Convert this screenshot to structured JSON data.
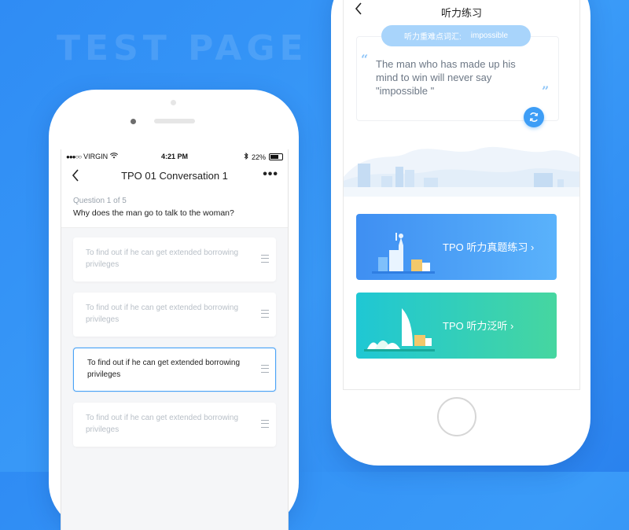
{
  "background_text": "TEST PAGE",
  "colors": {
    "background": "#2f8cf4",
    "accent": "#4aa3f6",
    "card_blue": "#3f8ff2",
    "card_green": "#1fc7d4"
  },
  "left_phone": {
    "status_bar": {
      "carrier": "VIRGIN",
      "time": "4:21 PM",
      "battery": "22%"
    },
    "nav": {
      "back_icon": "chevron-left-icon",
      "title": "TPO 01 Conversation 1",
      "more_icon": "more-horizontal-icon",
      "more_label": "•••"
    },
    "question": {
      "number": "Question 1 of 5",
      "text": "Why does the man go to talk to the woman?"
    },
    "options": [
      {
        "text": "To find out if he can get extended borrowing privileges",
        "selected": false
      },
      {
        "text": "To find out if he can get extended borrowing privileges",
        "selected": false
      },
      {
        "text": "To find out if he can get extended borrowing privileges",
        "selected": true
      },
      {
        "text": "To find out if he can get extended borrowing privileges",
        "selected": false
      }
    ]
  },
  "right_phone": {
    "nav": {
      "back_icon": "chevron-left-icon",
      "title": "听力练习"
    },
    "keyword_pill": {
      "label": "听力重难点词汇:",
      "word": "impossible"
    },
    "quote": {
      "open_mark": "“",
      "close_mark": "”",
      "text": "The man who has made up his mind to win will never say \"impossible \""
    },
    "refresh_icon": "refresh-icon",
    "entries": [
      {
        "label": "TPO 听力真题练习 ›",
        "illustration": "statue-of-liberty-illustration"
      },
      {
        "label": "TPO 听力泛听 ›",
        "illustration": "sydney-opera-house-illustration"
      }
    ]
  }
}
